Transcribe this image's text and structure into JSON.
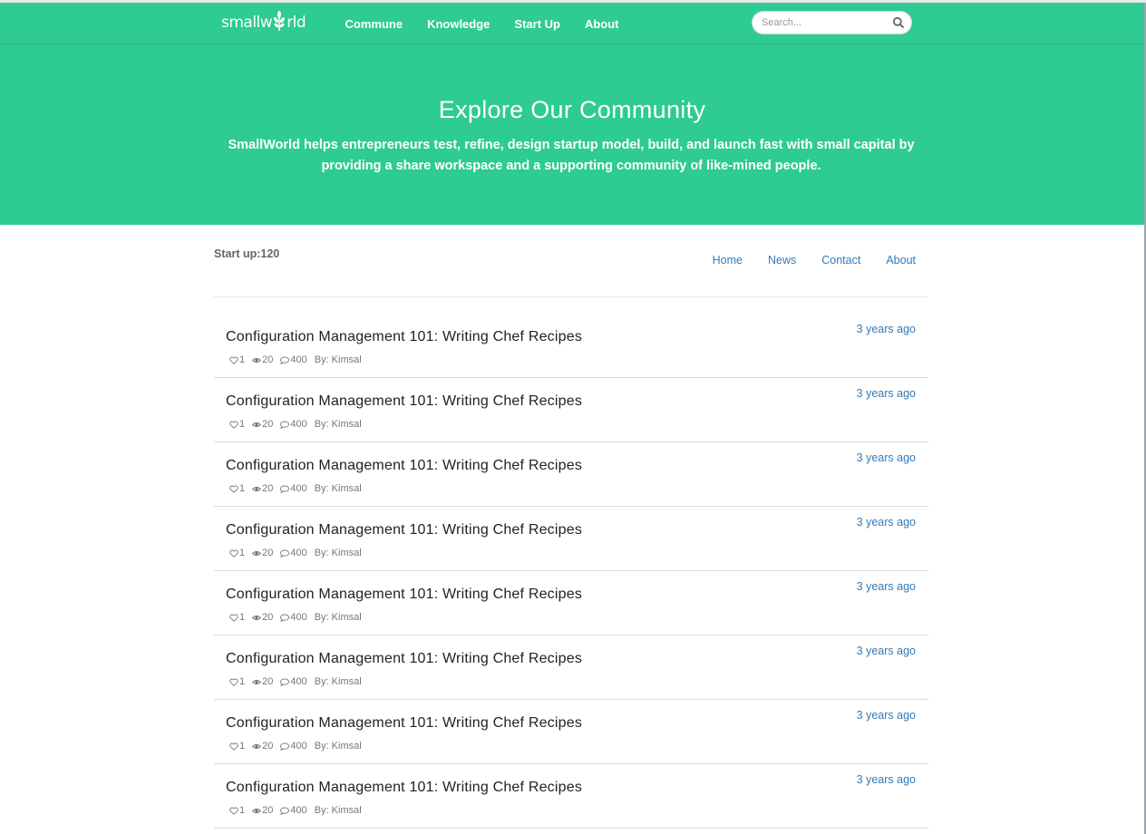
{
  "brand": {
    "logo_pre": "smallw",
    "logo_post": "rld"
  },
  "nav": {
    "items": [
      "Commune",
      "Knowledge",
      "Start Up",
      "About"
    ]
  },
  "search": {
    "placeholder": "Search..."
  },
  "hero": {
    "title": "Explore Our Community",
    "description": "SmallWorld helps entrepreneurs test, refine, design startup model, build, and launch fast with small capital by providing a share workspace and a supporting community of like-mined people."
  },
  "startup": {
    "label": "Start up:120"
  },
  "subnav": {
    "items": [
      "Home",
      "News",
      "Contact",
      "About"
    ]
  },
  "posts": [
    {
      "title": "Configuration Management 101: Writing Chef Recipes",
      "likes": "1",
      "views": "20",
      "comments": "400",
      "author": "By: Kimsal",
      "time": "3 years ago"
    },
    {
      "title": "Configuration Management 101: Writing Chef Recipes",
      "likes": "1",
      "views": "20",
      "comments": "400",
      "author": "By: Kimsal",
      "time": "3 years ago"
    },
    {
      "title": "Configuration Management 101: Writing Chef Recipes",
      "likes": "1",
      "views": "20",
      "comments": "400",
      "author": "By: Kimsal",
      "time": "3 years ago"
    },
    {
      "title": "Configuration Management 101: Writing Chef Recipes",
      "likes": "1",
      "views": "20",
      "comments": "400",
      "author": "By: Kimsal",
      "time": "3 years ago"
    },
    {
      "title": "Configuration Management 101: Writing Chef Recipes",
      "likes": "1",
      "views": "20",
      "comments": "400",
      "author": "By: Kimsal",
      "time": "3 years ago"
    },
    {
      "title": "Configuration Management 101: Writing Chef Recipes",
      "likes": "1",
      "views": "20",
      "comments": "400",
      "author": "By: Kimsal",
      "time": "3 years ago"
    },
    {
      "title": "Configuration Management 101: Writing Chef Recipes",
      "likes": "1",
      "views": "20",
      "comments": "400",
      "author": "By: Kimsal",
      "time": "3 years ago"
    },
    {
      "title": "Configuration Management 101: Writing Chef Recipes",
      "likes": "1",
      "views": "20",
      "comments": "400",
      "author": "By: Kimsal",
      "time": "3 years ago"
    }
  ],
  "icons": {
    "like": "heart-icon",
    "views": "eye-icon",
    "comments": "comment-icon",
    "search": "search-icon",
    "logo_leaf": "leaf-icon"
  },
  "colors": {
    "brand_green": "#2ecb92",
    "link_blue": "#337ab7"
  }
}
